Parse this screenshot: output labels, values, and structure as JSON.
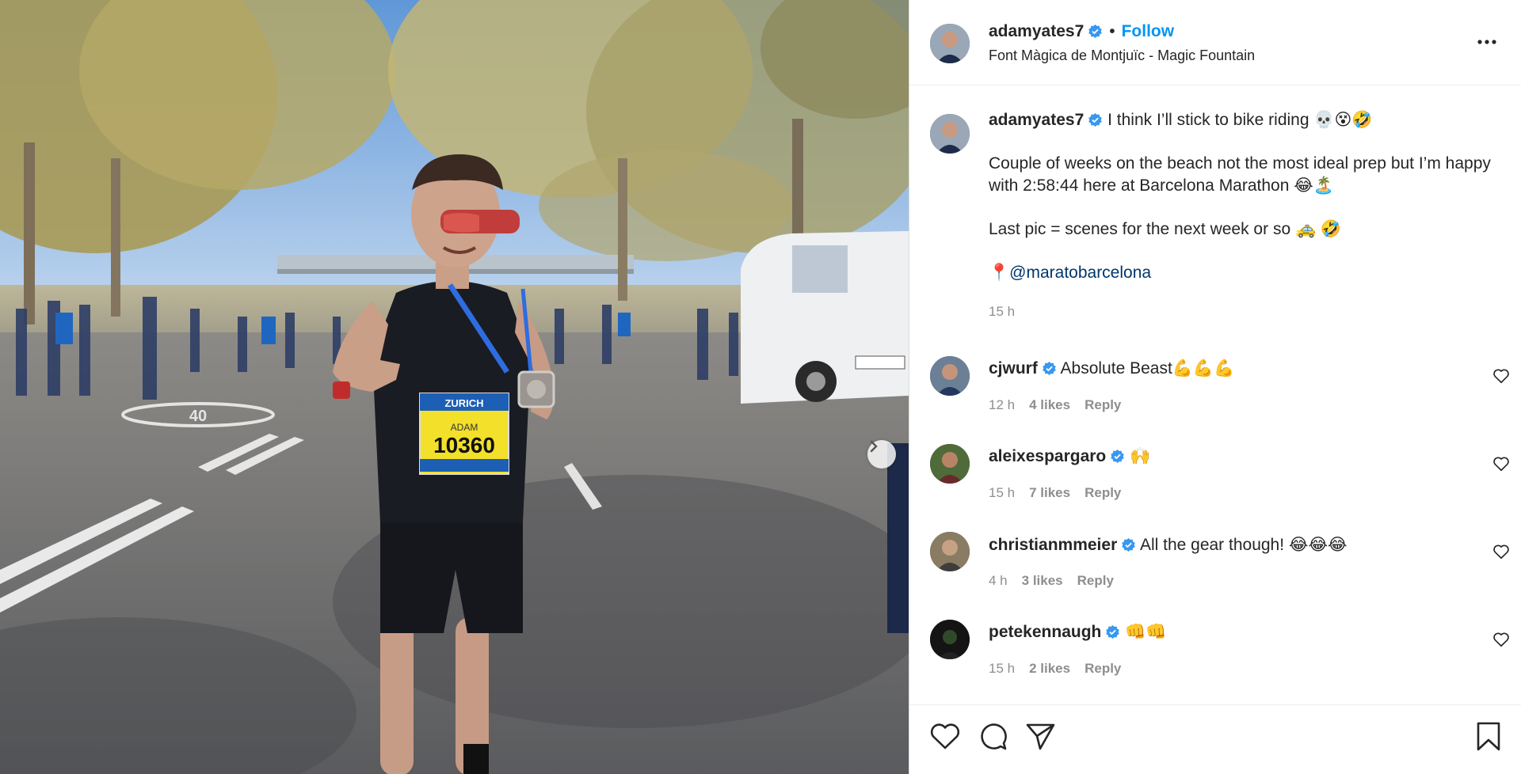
{
  "post": {
    "username": "adamyates7",
    "follow_label": "Follow",
    "separator": "•",
    "location": "Font Màgica de Montjuïc - Magic Fountain",
    "more_icon": "more-horizontal-icon"
  },
  "photo": {
    "bib_sponsor": "ZURICH",
    "bib_name": "ADAM",
    "bib_number": "10360",
    "road_marking": "40"
  },
  "caption": {
    "username": "adamyates7",
    "line1": "I think I’ll stick to bike riding 💀😵🤣",
    "para2": "Couple of weeks on the beach not the most ideal prep but I’m happy with 2:58:44 here at Barcelona Marathon 😂🏝️",
    "para3": "Last pic = scenes for the next week or so 🚕 🤣",
    "pin": "📍",
    "mention": "@maratobarcelona",
    "time": "15 h"
  },
  "comments": [
    {
      "username": "cjwurf",
      "text": "Absolute Beast💪💪💪",
      "time": "12 h",
      "likes": "4 likes",
      "reply": "Reply"
    },
    {
      "username": "aleixespargaro",
      "text": "🙌",
      "time": "15 h",
      "likes": "7 likes",
      "reply": "Reply"
    },
    {
      "username": "christianmmeier",
      "text": "All the gear though! 😂😂😂",
      "time": "4 h",
      "likes": "3 likes",
      "reply": "Reply"
    },
    {
      "username": "petekennaugh",
      "text": "👊👊",
      "time": "15 h",
      "likes": "2 likes",
      "reply": "Reply"
    }
  ],
  "colors": {
    "accent": "#0095f6",
    "verified": "#3897f0",
    "muted": "#8e8e8e",
    "mention": "#00376b"
  },
  "icons": [
    "heart-icon",
    "comment-icon",
    "share-icon",
    "save-icon",
    "verified-badge-icon",
    "chevron-right-icon"
  ]
}
